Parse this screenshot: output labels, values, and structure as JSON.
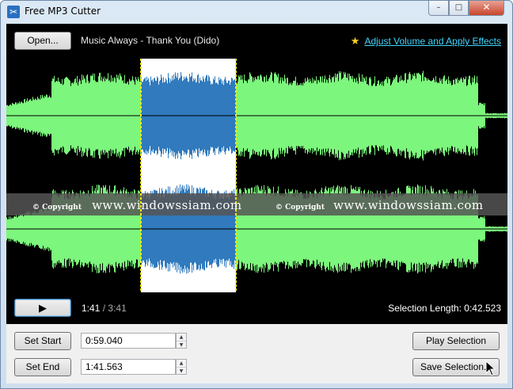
{
  "window": {
    "title": "Free MP3 Cutter",
    "min_glyph": "–",
    "max_glyph": "□",
    "close_glyph": "✕"
  },
  "toolbar": {
    "open_label": "Open...",
    "track_title": "Music Always - Thank You (Dido)",
    "effects_label": "Adjust Volume and Apply Effects",
    "star_glyph": "★"
  },
  "waveform": {
    "selection_start": 0.2681,
    "selection_end": 0.4583,
    "wave_color": "#7cf67c",
    "selection_bg": "#ffffff",
    "selection_wave_color": "#1a6bb6",
    "marker_color": "#ffe600",
    "background": "#000000"
  },
  "watermark": {
    "copyright": "© Copyright",
    "site": "www.windowssiam.com"
  },
  "transport": {
    "play_glyph": "▶",
    "current_time": "1:41",
    "separator": "/",
    "total_time": "3:41",
    "selection_length_label": "Selection Length:",
    "selection_length_value": "0:42.523"
  },
  "controls": {
    "set_start_label": "Set Start",
    "start_value": "0:59.040",
    "set_end_label": "Set End",
    "end_value": "1:41.563",
    "play_selection_label": "Play Selection",
    "save_selection_label": "Save Selection...",
    "spin_up": "▲",
    "spin_down": "▼"
  }
}
